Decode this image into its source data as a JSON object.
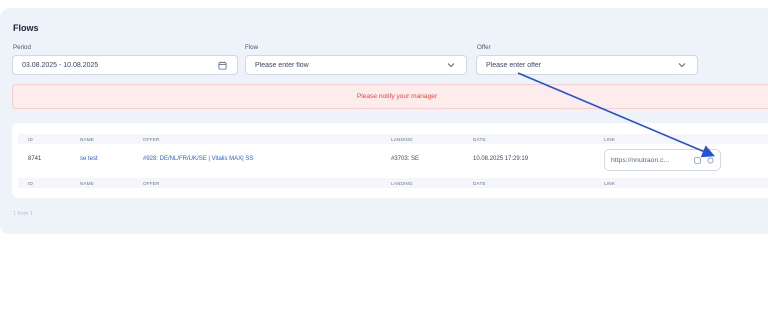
{
  "page": {
    "title": "Flows"
  },
  "filters": {
    "period": {
      "label": "Period",
      "value": "03.08.2025 - 10.08.2025",
      "icon": "calendar-icon"
    },
    "flow": {
      "label": "Flow",
      "placeholder": "Please enter flow",
      "icon": "chevron-down-icon"
    },
    "offer": {
      "label": "Offer",
      "placeholder": "Please enter offer",
      "icon": "chevron-down-icon"
    }
  },
  "alert": {
    "text": "Please notify your manager",
    "color": "#e0493f"
  },
  "table": {
    "columns": [
      "ID",
      "NAME",
      "OFFER",
      "LANDING",
      "DATE",
      "LINK"
    ],
    "rows": [
      {
        "id": "8741",
        "name": "se test",
        "offer": "#928: DE/NL/FR/UK/SE | Vitalis MAX| SS",
        "landing": "#3703: SE",
        "date": "10.08.2025 17:29:19",
        "link": "https://nnutraon.c..."
      }
    ]
  },
  "pagination": {
    "text": "1 from 1"
  },
  "colors": {
    "accent": "#2a64c9",
    "arrow": "#2451d6",
    "panel": "#eef3f9"
  }
}
